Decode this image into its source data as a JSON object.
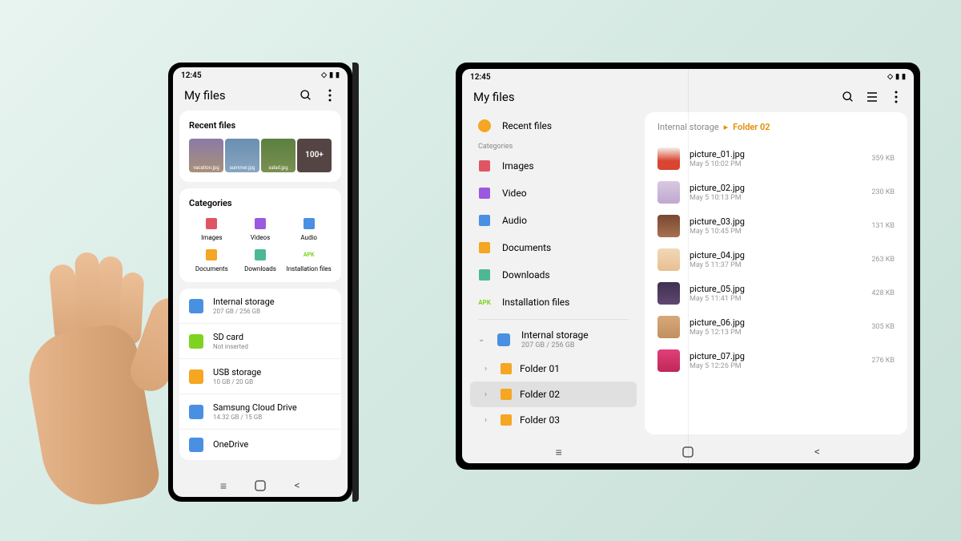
{
  "status": {
    "time": "12:45"
  },
  "phone": {
    "title": "My files",
    "recent": {
      "title": "Recent files",
      "thumbs": [
        "vacation.jpg",
        "summer.jpg",
        "salad.jpg",
        "100+"
      ]
    },
    "categories": {
      "title": "Categories",
      "items": [
        {
          "label": "Images",
          "color": "#e05563"
        },
        {
          "label": "Videos",
          "color": "#9b59e0"
        },
        {
          "label": "Audio",
          "color": "#4a90e2"
        },
        {
          "label": "Documents",
          "color": "#f5a623"
        },
        {
          "label": "Downloads",
          "color": "#4cb894"
        },
        {
          "label": "Installation files",
          "color": "#7ed321",
          "badge": "APK"
        }
      ]
    },
    "storage": [
      {
        "name": "Internal storage",
        "sub": "207 GB / 256 GB",
        "color": "#4a90e2"
      },
      {
        "name": "SD card",
        "sub": "Not inserted",
        "color": "#7ed321"
      },
      {
        "name": "USB storage",
        "sub": "10 GB / 20 GB",
        "color": "#f5a623"
      },
      {
        "name": "Samsung Cloud Drive",
        "sub": "14.32 GB / 15 GB",
        "color": "#4a90e2"
      },
      {
        "name": "OneDrive",
        "sub": "",
        "color": "#4a90e2"
      }
    ]
  },
  "tablet": {
    "title": "My files",
    "sidebar": {
      "recent": "Recent files",
      "catLabel": "Categories",
      "categories": [
        {
          "label": "Images",
          "color": "#e05563"
        },
        {
          "label": "Video",
          "color": "#9b59e0"
        },
        {
          "label": "Audio",
          "color": "#4a90e2"
        },
        {
          "label": "Documents",
          "color": "#f5a623"
        },
        {
          "label": "Downloads",
          "color": "#4cb894"
        },
        {
          "label": "Installation files",
          "color": "#7ed321",
          "badge": "APK"
        }
      ],
      "storage": {
        "name": "Internal storage",
        "sub": "207 GB / 256 GB"
      },
      "folders": [
        {
          "label": "Folder 01",
          "active": false
        },
        {
          "label": "Folder 02",
          "active": true
        },
        {
          "label": "Folder 03",
          "active": false
        }
      ]
    },
    "breadcrumb": {
      "parent": "Internal storage",
      "current": "Folder 02"
    },
    "files": [
      {
        "name": "picture_01.jpg",
        "date": "May 5 10:02 PM",
        "size": "359 KB"
      },
      {
        "name": "picture_02.jpg",
        "date": "May 5 10:13 PM",
        "size": "230 KB"
      },
      {
        "name": "picture_03.jpg",
        "date": "May 5 10:45 PM",
        "size": "131 KB"
      },
      {
        "name": "picture_04.jpg",
        "date": "May 5 11:37 PM",
        "size": "263 KB"
      },
      {
        "name": "picture_05.jpg",
        "date": "May 5 11:41 PM",
        "size": "428 KB"
      },
      {
        "name": "picture_06.jpg",
        "date": "May 5 12:13 PM",
        "size": "305 KB"
      },
      {
        "name": "picture_07.jpg",
        "date": "May 5 12:26 PM",
        "size": "276 KB"
      }
    ]
  }
}
